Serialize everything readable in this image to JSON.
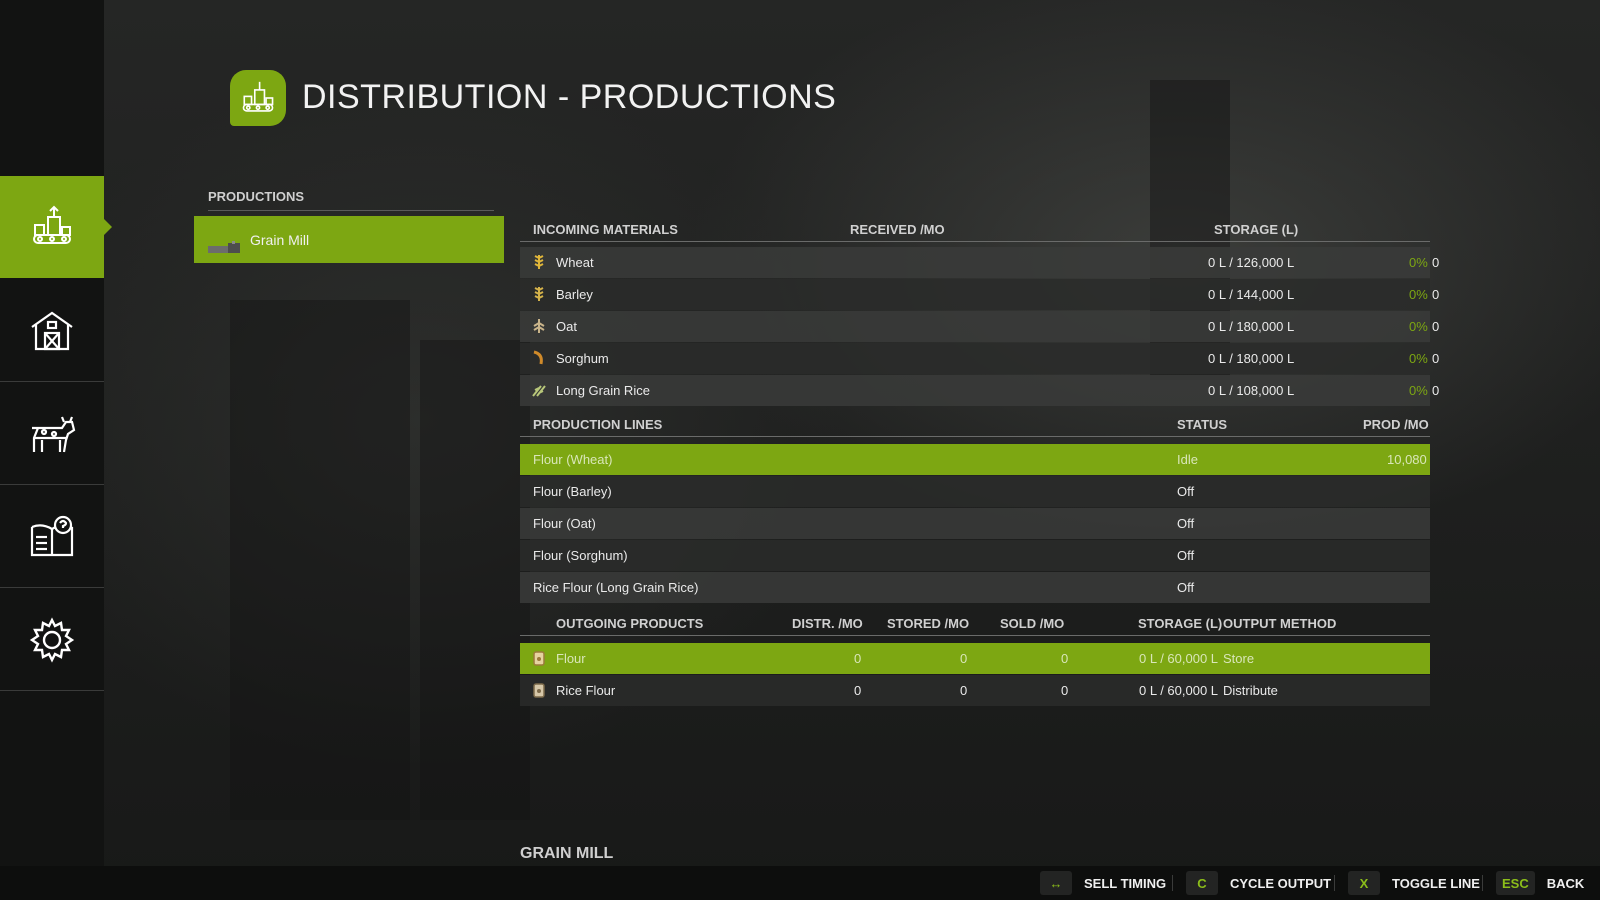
{
  "header": {
    "title": "DISTRIBUTION - PRODUCTIONS",
    "icon": "production-icon"
  },
  "sidebar": {
    "items": [
      {
        "name": "production",
        "icon": "production-icon",
        "active": true
      },
      {
        "name": "farm",
        "icon": "barn-icon",
        "active": false
      },
      {
        "name": "animals",
        "icon": "cow-icon",
        "active": false
      },
      {
        "name": "help",
        "icon": "help-book-icon",
        "active": false
      },
      {
        "name": "settings",
        "icon": "gear-icon",
        "active": false
      }
    ]
  },
  "productions_list": {
    "header": "PRODUCTIONS",
    "items": [
      {
        "label": "Grain Mill",
        "selected": true
      }
    ]
  },
  "incoming": {
    "headers": {
      "name": "INCOMING MATERIALS",
      "received": "RECEIVED /MO",
      "storage": "STORAGE (L)"
    },
    "rows": [
      {
        "name": "Wheat",
        "received": "0",
        "storage": "0 L / 126,000 L",
        "pct": "0%"
      },
      {
        "name": "Barley",
        "received": "0",
        "storage": "0 L / 144,000 L",
        "pct": "0%"
      },
      {
        "name": "Oat",
        "received": "0",
        "storage": "0 L / 180,000 L",
        "pct": "0%"
      },
      {
        "name": "Sorghum",
        "received": "0",
        "storage": "0 L / 180,000 L",
        "pct": "0%"
      },
      {
        "name": "Long Grain Rice",
        "received": "0",
        "storage": "0 L / 108,000 L",
        "pct": "0%"
      }
    ]
  },
  "production_lines": {
    "headers": {
      "name": "PRODUCTION LINES",
      "status": "STATUS",
      "prod": "PROD /MO"
    },
    "rows": [
      {
        "name": "Flour (Wheat)",
        "status": "Idle",
        "prod": "10,080"
      },
      {
        "name": "Flour (Barley)",
        "status": "Off",
        "prod": ""
      },
      {
        "name": "Flour (Oat)",
        "status": "Off",
        "prod": ""
      },
      {
        "name": "Flour (Sorghum)",
        "status": "Off",
        "prod": ""
      },
      {
        "name": "Rice Flour (Long Grain Rice)",
        "status": "Off",
        "prod": ""
      }
    ]
  },
  "outgoing": {
    "headers": {
      "name": "OUTGOING PRODUCTS",
      "distr": "DISTR. /MO",
      "stored": "STORED /MO",
      "sold": "SOLD /MO",
      "storage": "STORAGE (L)",
      "method": "OUTPUT METHOD"
    },
    "rows": [
      {
        "name": "Flour",
        "distr": "0",
        "stored": "0",
        "sold": "0",
        "storage": "0 L / 60,000 L",
        "method": "Store"
      },
      {
        "name": "Rice Flour",
        "distr": "0",
        "stored": "0",
        "sold": "0",
        "storage": "0 L / 60,000 L",
        "method": "Distribute"
      }
    ]
  },
  "subtitle": "GRAIN MILL",
  "keybinds": [
    {
      "key": "↔",
      "label": "SELL TIMING"
    },
    {
      "key": "C",
      "label": "CYCLE OUTPUT"
    },
    {
      "key": "X",
      "label": "TOGGLE LINE"
    },
    {
      "key": "ESC",
      "label": "BACK"
    }
  ],
  "colors": {
    "accent": "#7da712",
    "background": "#1c1d1c",
    "sidebar": "#121312"
  }
}
